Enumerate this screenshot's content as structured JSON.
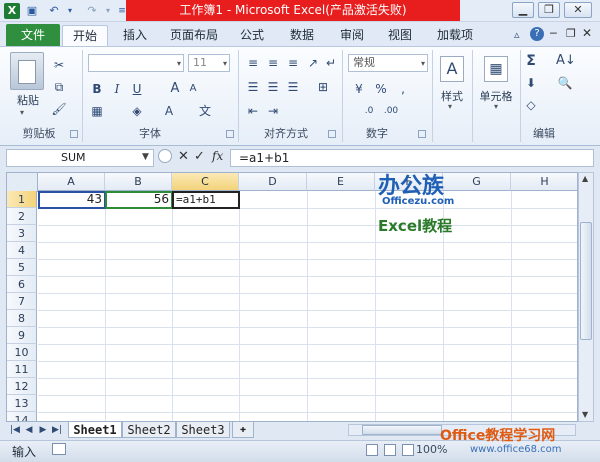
{
  "window": {
    "title": "工作簿1 - Microsoft Excel(产品激活失败)",
    "minimize_icon": "minimize-icon",
    "restore_icon": "restore-icon",
    "close_icon": "close-icon"
  },
  "quick_access": {
    "excel_logo": "excel-icon",
    "save": "save-icon",
    "undo": "undo-icon",
    "redo": "redo-icon"
  },
  "tabs": {
    "file": "文件",
    "home": "开始",
    "insert": "插入",
    "page_layout": "页面布局",
    "formulas": "公式",
    "data": "数据",
    "review": "审阅",
    "view": "视图",
    "addins": "加载项"
  },
  "ribbon": {
    "clipboard": {
      "label": "剪贴板",
      "paste": "粘贴"
    },
    "font": {
      "label": "字体",
      "font_size": "11",
      "bold": "B",
      "italic": "I",
      "underline": "U"
    },
    "alignment": {
      "label": "对齐方式"
    },
    "number": {
      "label": "数字",
      "format": "常规"
    },
    "styles": {
      "label": "样式"
    },
    "cells": {
      "label": "单元格"
    },
    "editing": {
      "label": "编辑"
    }
  },
  "formula_bar": {
    "name_box": "SUM",
    "formula": "=a1+b1"
  },
  "grid": {
    "columns": [
      "A",
      "B",
      "C",
      "D",
      "E",
      "F",
      "G",
      "H"
    ],
    "rows": [
      "1",
      "2",
      "3",
      "4",
      "5",
      "6",
      "7",
      "8",
      "9",
      "10",
      "11",
      "12",
      "13",
      "14"
    ],
    "cells": {
      "A1": "43",
      "B1": "56",
      "C1": "=a1+b1"
    }
  },
  "sheets": [
    "Sheet1",
    "Sheet2",
    "Sheet3"
  ],
  "status": {
    "mode": "输入",
    "zoom": "100%"
  },
  "watermarks": {
    "logo_text": "办公族",
    "site_small": "Officezu.com",
    "tutorial": "Excel教程",
    "bottom_title": "Office教程学习网",
    "bottom_url": "www.office68.com"
  }
}
